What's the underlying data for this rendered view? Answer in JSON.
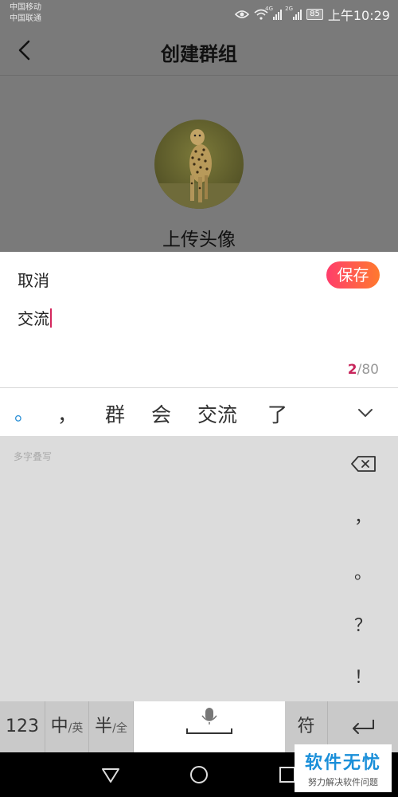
{
  "status_bar": {
    "carrier_1": "中国移动",
    "carrier_2": "中国联通",
    "signal_1_tag": "4G",
    "signal_2_tag": "2G",
    "battery": "85",
    "time": "上午10:29"
  },
  "header": {
    "back_icon": "chevron-left-icon",
    "title": "创建群组"
  },
  "avatar": {
    "upload_label": "上传头像"
  },
  "dialog": {
    "cancel_label": "取消",
    "save_label": "保存",
    "input_value": "交流",
    "counter_current": "2",
    "counter_max": "/80"
  },
  "candidates": {
    "items": [
      "。",
      "，",
      "群",
      "会",
      "交流",
      "了"
    ],
    "collapse_icon": "chevron-down-icon"
  },
  "keyboard": {
    "handwriting_hint": "多字叠写",
    "side_keys": [
      "，",
      "。",
      "？",
      "！"
    ],
    "backspace_icon": "backspace-icon",
    "numbers_key": "123",
    "chinese_key_main": "中",
    "chinese_key_sub": "/英",
    "half_key_main": "半",
    "half_key_sub": "/全",
    "mic_icon": "microphone-icon",
    "symbol_key": "符",
    "enter_icon": "enter-icon"
  },
  "nav_bar": {
    "back_icon": "triangle-back-icon",
    "home_icon": "circle-home-icon",
    "recents_icon": "square-recents-icon"
  },
  "watermark": {
    "title": "软件无忧",
    "subtitle": "努力解决软件问题"
  },
  "colors": {
    "accent": "#c8265c",
    "save_gradient_start": "#ff3d6b",
    "save_gradient_end": "#ff7a2e",
    "watermark_blue": "#1a8fd9"
  }
}
